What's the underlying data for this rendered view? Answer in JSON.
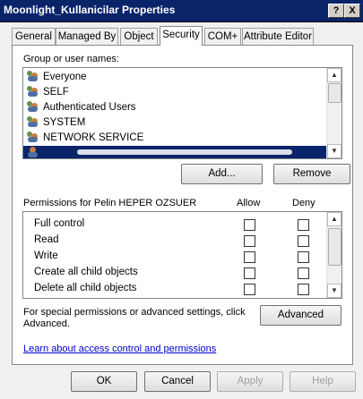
{
  "window": {
    "title": "Moonlight_Kullanicilar Properties",
    "help_label": "?",
    "close_label": "X"
  },
  "tabs": [
    {
      "label": "General"
    },
    {
      "label": "Managed By"
    },
    {
      "label": "Object"
    },
    {
      "label": "Security"
    },
    {
      "label": "COM+"
    },
    {
      "label": "Attribute Editor"
    }
  ],
  "active_tab": "Security",
  "group_label": "Group or user names:",
  "users": [
    {
      "name": "Everyone"
    },
    {
      "name": "SELF"
    },
    {
      "name": "Authenticated Users"
    },
    {
      "name": "SYSTEM"
    },
    {
      "name": "NETWORK SERVICE"
    }
  ],
  "buttons": {
    "add": "Add...",
    "remove": "Remove",
    "advanced": "Advanced",
    "ok": "OK",
    "cancel": "Cancel",
    "apply": "Apply",
    "help": "Help"
  },
  "permissions": {
    "header": "Permissions for Pelin HEPER OZSUER",
    "allow_label": "Allow",
    "deny_label": "Deny",
    "rows": [
      {
        "name": "Full control"
      },
      {
        "name": "Read"
      },
      {
        "name": "Write"
      },
      {
        "name": "Create all child objects"
      },
      {
        "name": "Delete all child objects"
      }
    ]
  },
  "special_text": "For special permissions or advanced settings, click Advanced.",
  "learn_link": "Learn about access control and permissions"
}
